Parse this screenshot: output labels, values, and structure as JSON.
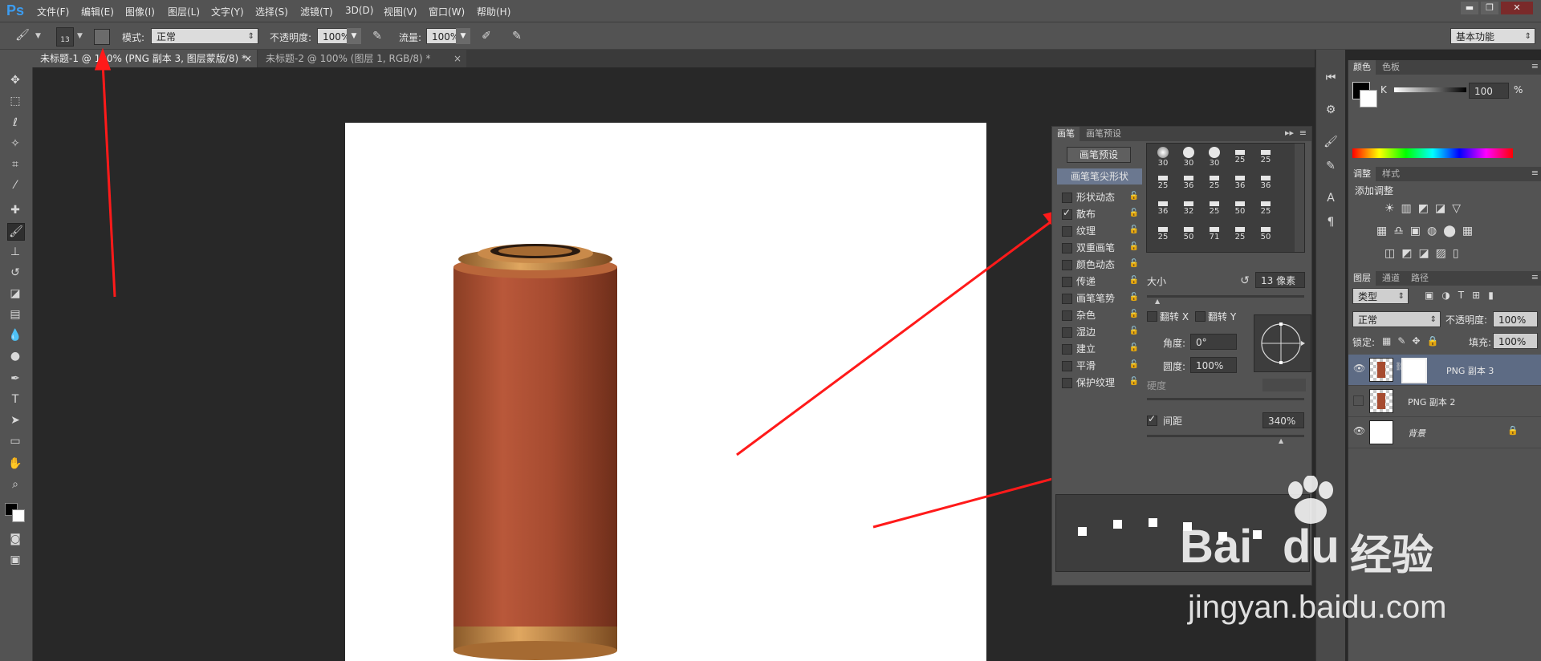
{
  "app": {
    "logo": "Ps"
  },
  "menu": {
    "items": [
      "文件(F)",
      "编辑(E)",
      "图像(I)",
      "图层(L)",
      "文字(Y)",
      "选择(S)",
      "滤镜(T)",
      "3D(D)",
      "视图(V)",
      "窗口(W)",
      "帮助(H)"
    ]
  },
  "options": {
    "brush_size": "13",
    "mode_label": "模式:",
    "mode_value": "正常",
    "opacity_label": "不透明度:",
    "opacity_value": "100%",
    "flow_label": "流量:",
    "flow_value": "100%",
    "workspace": "基本功能"
  },
  "tabs": [
    {
      "label": "未标题-1 @ 100% (PNG 副本 3, 图层蒙版/8) *",
      "close": "×"
    },
    {
      "label": "未标题-2 @ 100% (图层 1, RGB/8) *",
      "close": "×"
    }
  ],
  "brush_panel": {
    "tabs": [
      "画笔",
      "画笔预设"
    ],
    "preset_button": "画笔预设",
    "tip_shape": "画笔笔尖形状",
    "options": [
      {
        "label": "形状动态",
        "checked": false
      },
      {
        "label": "散布",
        "checked": true
      },
      {
        "label": "纹理",
        "checked": false
      },
      {
        "label": "双重画笔",
        "checked": false
      },
      {
        "label": "颜色动态",
        "checked": false
      },
      {
        "label": "传递",
        "checked": false
      },
      {
        "label": "画笔笔势",
        "checked": false
      },
      {
        "label": "杂色",
        "checked": false
      },
      {
        "label": "湿边",
        "checked": false
      },
      {
        "label": "建立",
        "checked": false
      },
      {
        "label": "平滑",
        "checked": false
      },
      {
        "label": "保护纹理",
        "checked": false
      }
    ],
    "tip_sizes": [
      "30",
      "30",
      "30",
      "25",
      "25",
      "25",
      "36",
      "25",
      "36",
      "36",
      "36",
      "32",
      "25",
      "50",
      "25",
      "25",
      "50",
      "71",
      "25",
      "50"
    ],
    "size_label": "大小",
    "size_value": "13 像素",
    "flip_x": "翻转 X",
    "flip_y": "翻转 Y",
    "angle_label": "角度:",
    "angle_value": "0°",
    "roundness_label": "圆度:",
    "roundness_value": "100%",
    "hardness_label": "硬度",
    "spacing_label": "间距",
    "spacing_value": "340%",
    "spacing_checked": true
  },
  "color_panel": {
    "tabs": [
      "颜色",
      "色板"
    ],
    "channel": "K",
    "value": "100",
    "unit": "%"
  },
  "adjust_panel": {
    "tabs": [
      "调整",
      "样式"
    ],
    "title": "添加调整"
  },
  "layers_panel": {
    "tabs": [
      "图层",
      "通道",
      "路径"
    ],
    "filter_value": "类型",
    "blend_mode": "正常",
    "opacity_label": "不透明度:",
    "opacity_value": "100%",
    "lock_label": "锁定:",
    "fill_label": "填充:",
    "fill_value": "100%",
    "layers": [
      {
        "name": "PNG 副本 3",
        "visible": true,
        "selected": true
      },
      {
        "name": "PNG 副本 2",
        "visible": false,
        "selected": false
      },
      {
        "name": "背景",
        "visible": true,
        "selected": false
      }
    ]
  },
  "watermark": {
    "brand": "Bai",
    "brand2": "du",
    "cn": "经验",
    "url": "jingyan.baidu.com"
  },
  "colors": {
    "accent_arrow": "#ff1a1a",
    "ps_blue": "#3c9cf0"
  }
}
